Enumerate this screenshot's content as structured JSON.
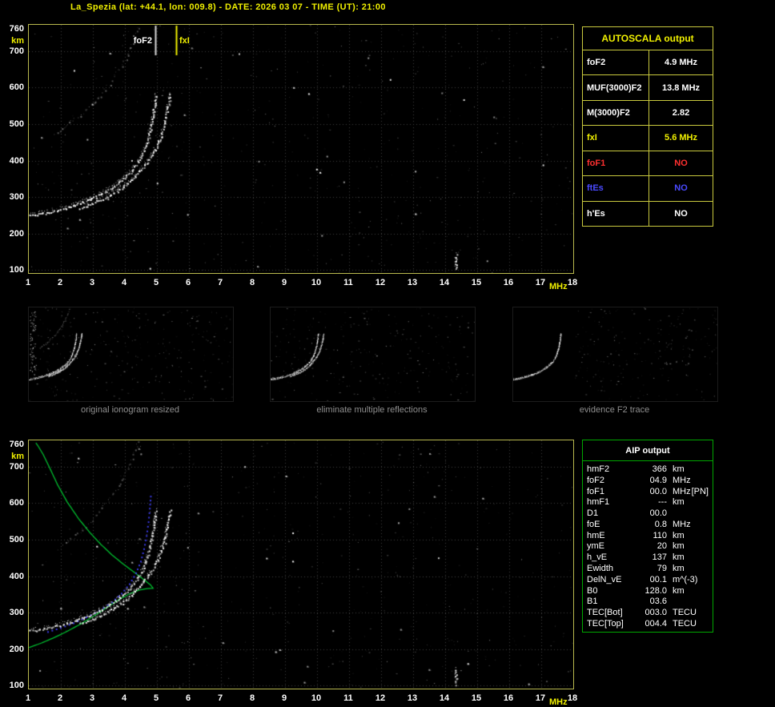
{
  "window_title": "La_Spezia (lat: +44.1, lon: 009.8) - DATE: 2026 03 07 - TIME (UT): 21:00",
  "colors": {
    "yellow": "#f0f000",
    "border_yellow": "#c9c93e",
    "green_border": "#00a800",
    "profile_green": "#00c030",
    "restored_blue": "#4040ff",
    "red": "#ff3030",
    "blue": "#4a4aff",
    "white": "#ffffff",
    "caption_gray": "#8f8f8f"
  },
  "autoscala_table": {
    "title": "AUTOSCALA output",
    "rows": [
      {
        "label": "foF2",
        "value": "4.9 MHz",
        "color": "#ffffff"
      },
      {
        "label": "MUF(3000)F2",
        "value": "13.8 MHz",
        "color": "#ffffff"
      },
      {
        "label": "M(3000)F2",
        "value": "2.82",
        "color": "#ffffff"
      },
      {
        "label": "fxI",
        "value": "5.6 MHz",
        "color": "#f0f000"
      },
      {
        "label": "foF1",
        "value": "NO",
        "color": "#ff3030"
      },
      {
        "label": "ftEs",
        "value": "NO",
        "color": "#4a4aff"
      },
      {
        "label": "h'Es",
        "value": "NO",
        "color": "#ffffff"
      }
    ]
  },
  "aip_table": {
    "title": "AIP output",
    "rows": [
      {
        "label": "hmF2",
        "value": "366",
        "unit": "km",
        "note": ""
      },
      {
        "label": "foF2",
        "value": "04.9",
        "unit": "MHz",
        "note": ""
      },
      {
        "label": "foF1",
        "value": "00.0",
        "unit": "MHz",
        "note": "[PN]"
      },
      {
        "label": "hmF1",
        "value": "---",
        "unit": "km",
        "note": ""
      },
      {
        "label": "D1",
        "value": "00.0",
        "unit": "",
        "note": ""
      },
      {
        "label": "foE",
        "value": "0.8",
        "unit": "MHz",
        "note": ""
      },
      {
        "label": "hmE",
        "value": "110",
        "unit": "km",
        "note": ""
      },
      {
        "label": "ymE",
        "value": "20",
        "unit": "km",
        "note": ""
      },
      {
        "label": "h_vE",
        "value": "137",
        "unit": "km",
        "note": ""
      },
      {
        "label": "Ewidth",
        "value": "79",
        "unit": "km",
        "note": ""
      },
      {
        "label": "DelN_vE",
        "value": "00.1",
        "unit": "m^(-3)",
        "note": ""
      },
      {
        "label": "B0",
        "value": "128.0",
        "unit": "km",
        "note": ""
      },
      {
        "label": "B1",
        "value": "03.6",
        "unit": "",
        "note": ""
      },
      {
        "label": "TEC[Bot]",
        "value": "003.0",
        "unit": "TECU",
        "note": ""
      },
      {
        "label": "TEC[Top]",
        "value": "004.4",
        "unit": "TECU",
        "note": ""
      }
    ]
  },
  "thumbnails": [
    {
      "caption": "original ionogram resized",
      "shows": [
        "second reflection",
        "F2 trace (ordinary)",
        "F2 trace (extraordinary)"
      ],
      "left_band": true,
      "noise": 300,
      "noise_bias": "uniform"
    },
    {
      "caption": "eliminate multiple reflections",
      "shows": [
        "F2 trace (ordinary)",
        "F2 trace (extraordinary)"
      ],
      "left_band": false,
      "noise": 260,
      "noise_bias": "uniform"
    },
    {
      "caption": "evidence F2 trace",
      "shows": [
        "F2 trace (ordinary)"
      ],
      "left_band": false,
      "noise": 220,
      "noise_bias": "right"
    }
  ],
  "chart_data": [
    {
      "type": "scatter",
      "name": "ionogram (measured echoes)",
      "xlabel": "MHz",
      "ylabel": "km",
      "xlim": [
        1,
        18
      ],
      "ylim": [
        100,
        760
      ],
      "grid": true,
      "xticks": [
        1,
        2,
        3,
        4,
        5,
        6,
        7,
        8,
        9,
        10,
        11,
        12,
        13,
        14,
        15,
        16,
        17,
        18
      ],
      "yticks": [
        760,
        700,
        600,
        500,
        400,
        300,
        200,
        100
      ],
      "annotations": [
        {
          "label": "foF2",
          "freq": 4.95,
          "color": "#d8d8d8"
        },
        {
          "label": "fxI",
          "freq": 5.6,
          "color": "#f0f000"
        }
      ],
      "series": [
        {
          "name": "second reflection",
          "style": "band-faint",
          "color": "#c8c8c8",
          "points": [
            [
              1.9,
              476
            ],
            [
              2.3,
              503
            ],
            [
              2.7,
              533
            ],
            [
              3.1,
              566
            ],
            [
              3.45,
              603
            ],
            [
              3.75,
              641
            ],
            [
              4.0,
              680
            ],
            [
              4.2,
              718
            ],
            [
              4.35,
              755
            ],
            [
              4.4,
              768
            ]
          ]
        },
        {
          "name": "F2 trace (ordinary)",
          "style": "band",
          "color": "#ffffff",
          "points": [
            [
              1.0,
              250
            ],
            [
              1.3,
              254
            ],
            [
              1.6,
              259
            ],
            [
              2.0,
              267
            ],
            [
              2.4,
              278
            ],
            [
              2.8,
              291
            ],
            [
              3.2,
              307
            ],
            [
              3.6,
              327
            ],
            [
              3.9,
              347
            ],
            [
              4.2,
              372
            ],
            [
              4.45,
              402
            ],
            [
              4.6,
              430
            ],
            [
              4.72,
              462
            ],
            [
              4.82,
              500
            ],
            [
              4.9,
              540
            ],
            [
              4.95,
              578
            ]
          ]
        },
        {
          "name": "F2 trace (extraordinary)",
          "style": "band",
          "color": "#ffffff",
          "points": [
            [
              2.6,
              272
            ],
            [
              3.0,
              284
            ],
            [
              3.4,
              300
            ],
            [
              3.8,
              320
            ],
            [
              4.1,
              340
            ],
            [
              4.4,
              366
            ],
            [
              4.7,
              398
            ],
            [
              4.95,
              432
            ],
            [
              5.1,
              465
            ],
            [
              5.22,
              500
            ],
            [
              5.32,
              540
            ],
            [
              5.4,
              580
            ]
          ]
        },
        {
          "name": "interference mark",
          "style": "band",
          "color": "#ffffff",
          "points": [
            [
              14.33,
              142
            ],
            [
              14.33,
              106
            ]
          ]
        }
      ]
    },
    {
      "type": "scatter",
      "name": "ionogram with AIP profile",
      "xlabel": "MHz",
      "ylabel": "km",
      "xlim": [
        1,
        18
      ],
      "ylim": [
        100,
        760
      ],
      "grid": true,
      "xticks": [
        1,
        2,
        3,
        4,
        5,
        6,
        7,
        8,
        9,
        10,
        11,
        12,
        13,
        14,
        15,
        16,
        17,
        18
      ],
      "yticks": [
        760,
        700,
        600,
        500,
        400,
        300,
        200,
        100
      ],
      "annotations": [],
      "series": [
        {
          "name": "second reflection",
          "style": "band-faint",
          "color": "#c8c8c8",
          "points": [
            [
              1.9,
              476
            ],
            [
              2.3,
              503
            ],
            [
              2.7,
              533
            ],
            [
              3.1,
              566
            ],
            [
              3.45,
              603
            ],
            [
              3.75,
              641
            ],
            [
              4.0,
              680
            ],
            [
              4.2,
              718
            ],
            [
              4.35,
              755
            ],
            [
              4.4,
              768
            ]
          ]
        },
        {
          "name": "electron density profile",
          "style": "line",
          "color": "#00c030",
          "points": [
            [
              1.0,
              204
            ],
            [
              1.4,
              217
            ],
            [
              1.8,
              232
            ],
            [
              2.2,
              249
            ],
            [
              2.6,
              268
            ],
            [
              3.0,
              289
            ],
            [
              3.4,
              312
            ],
            [
              3.8,
              335
            ],
            [
              4.15,
              352
            ],
            [
              4.45,
              362
            ],
            [
              4.7,
              366
            ],
            [
              4.88,
              367
            ],
            [
              4.8,
              376
            ],
            [
              4.6,
              390
            ],
            [
              4.3,
              410
            ],
            [
              3.95,
              433
            ],
            [
              3.6,
              458
            ],
            [
              3.25,
              487
            ],
            [
              2.9,
              520
            ],
            [
              2.55,
              558
            ],
            [
              2.2,
              603
            ],
            [
              1.9,
              650
            ],
            [
              1.65,
              697
            ],
            [
              1.45,
              733
            ],
            [
              1.3,
              755
            ],
            [
              1.22,
              765
            ]
          ]
        },
        {
          "name": "restored trace",
          "style": "dots",
          "color": "#4040ff",
          "points": [
            [
              1.6,
              247
            ],
            [
              2.0,
              258
            ],
            [
              2.4,
              271
            ],
            [
              2.8,
              287
            ],
            [
              3.2,
              305
            ],
            [
              3.6,
              328
            ],
            [
              3.9,
              352
            ],
            [
              4.15,
              378
            ],
            [
              4.35,
              408
            ],
            [
              4.5,
              440
            ],
            [
              4.6,
              474
            ],
            [
              4.68,
              510
            ],
            [
              4.74,
              548
            ],
            [
              4.78,
              585
            ],
            [
              4.81,
              618
            ]
          ]
        },
        {
          "name": "F2 trace (ordinary)",
          "style": "band",
          "color": "#ffffff",
          "points": [
            [
              1.0,
              250
            ],
            [
              1.3,
              254
            ],
            [
              1.6,
              259
            ],
            [
              2.0,
              267
            ],
            [
              2.4,
              278
            ],
            [
              2.8,
              291
            ],
            [
              3.2,
              307
            ],
            [
              3.6,
              327
            ],
            [
              3.9,
              347
            ],
            [
              4.2,
              372
            ],
            [
              4.45,
              402
            ],
            [
              4.6,
              430
            ],
            [
              4.72,
              462
            ],
            [
              4.82,
              500
            ],
            [
              4.9,
              540
            ],
            [
              4.95,
              578
            ]
          ]
        },
        {
          "name": "F2 trace (extraordinary)",
          "style": "band",
          "color": "#ffffff",
          "points": [
            [
              2.6,
              272
            ],
            [
              3.0,
              284
            ],
            [
              3.4,
              300
            ],
            [
              3.8,
              320
            ],
            [
              4.1,
              340
            ],
            [
              4.4,
              366
            ],
            [
              4.7,
              398
            ],
            [
              4.95,
              432
            ],
            [
              5.1,
              465
            ],
            [
              5.22,
              500
            ],
            [
              5.32,
              540
            ],
            [
              5.4,
              580
            ]
          ]
        },
        {
          "name": "interference mark",
          "style": "band",
          "color": "#ffffff",
          "points": [
            [
              14.33,
              142
            ],
            [
              14.33,
              105
            ]
          ]
        }
      ]
    }
  ]
}
